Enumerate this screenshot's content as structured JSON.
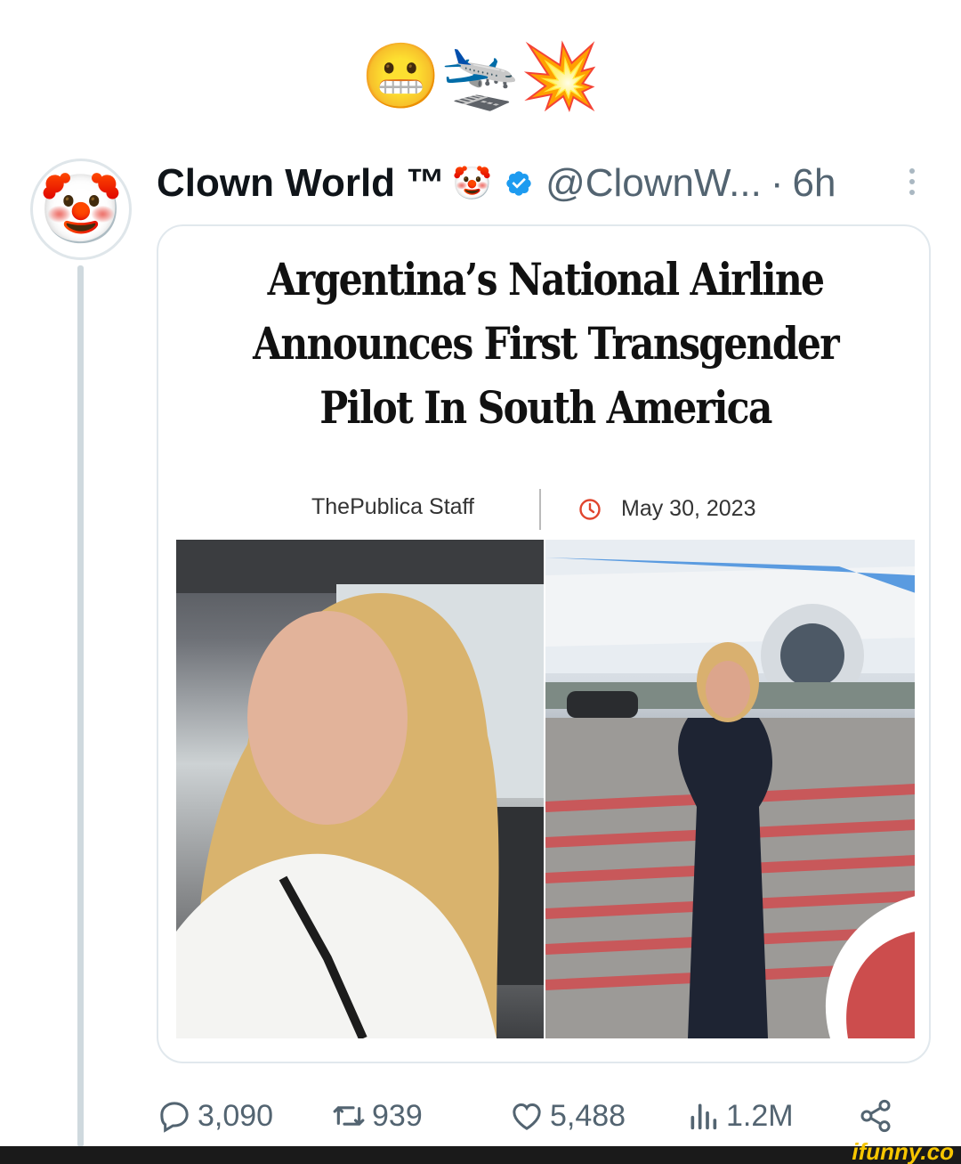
{
  "top_emojis": "😬🛬💥",
  "tweet": {
    "display_name": "Clown World ™",
    "name_emoji": "🤡",
    "avatar_emoji": "🤡",
    "handle": "@ClownW...",
    "separator": "·",
    "time": "6h"
  },
  "article": {
    "headline": "Argentina’s National Airline Announces First Transgender Pilot In South America",
    "author": "ThePublica Staff",
    "date": "May 30, 2023"
  },
  "metrics": {
    "replies": "3,090",
    "retweets": "939",
    "likes": "5,488",
    "views": "1.2M"
  },
  "colors": {
    "verified": "#1d9bf0",
    "icon_gray": "#536471",
    "clock": "#e0452e",
    "watermark": "#f7c600"
  },
  "watermark": "ifunny.co"
}
